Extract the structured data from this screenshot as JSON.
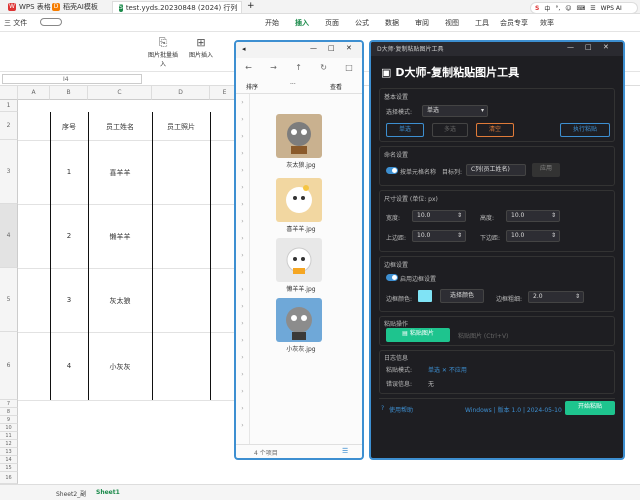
{
  "titlebar": {
    "tabs": [
      {
        "label": "WPS 表格",
        "icon": "wps-logo-icon",
        "color": "#d33"
      },
      {
        "label": "稻壳AI模板",
        "icon": "docer-logo-icon",
        "color": "#f57c00"
      },
      {
        "label": "test.yyds.20230848 (2024) 行列",
        "icon": "sheet-file-icon",
        "color": "#1a8a4a"
      }
    ],
    "new_tab": "+"
  },
  "sysbar": {
    "items": [
      "S",
      "中",
      "°,",
      "☺",
      "⌨",
      "☰",
      "WPS AI"
    ]
  },
  "menubar": {
    "items": [
      "三 文件",
      "开始插入",
      "",
      "开始",
      "插入",
      "页面",
      "公式",
      "数据",
      "审阅",
      "视图",
      "工具",
      "会员专享",
      "效率"
    ],
    "selected": "插入"
  },
  "ribbon": {
    "buttons": [
      {
        "label": "图片批量插入",
        "icon": "image-batch-icon"
      },
      {
        "label": "图片插入",
        "icon": "image-insert-icon"
      }
    ]
  },
  "formula": {
    "namebox": "I4"
  },
  "grid": {
    "columns": [
      "A",
      "B",
      "C",
      "D",
      "E"
    ],
    "rows": [
      "1",
      "2",
      "3",
      "4",
      "5",
      "6",
      "7",
      "8",
      "9",
      "10",
      "11",
      "12",
      "13",
      "14",
      "15",
      "16",
      "17",
      "18",
      "19",
      "20"
    ],
    "header": [
      "序号",
      "员工姓名",
      "员工照片"
    ],
    "data": [
      {
        "no": "1",
        "name": "喜羊羊"
      },
      {
        "no": "2",
        "name": "懒羊羊"
      },
      {
        "no": "3",
        "name": "灰太狼"
      },
      {
        "no": "4",
        "name": "小灰灰"
      }
    ]
  },
  "sheets": [
    "Sheet2_副",
    "Sheet1"
  ],
  "explorer": {
    "controls": [
      "—",
      "□",
      "✕"
    ],
    "nav": [
      "←",
      "→",
      "↑",
      "↻",
      "□"
    ],
    "sort_label": "排序",
    "more": "···",
    "view_label": "查看",
    "files": [
      {
        "name": "灰太狼.jpg",
        "icon": "wolf-image-icon",
        "color": "#c9b18f"
      },
      {
        "name": "喜羊羊.jpg",
        "icon": "pleasant-goat-image-icon",
        "color": "#f2d7a1"
      },
      {
        "name": "懒羊羊.jpg",
        "icon": "lazy-goat-image-icon",
        "color": "#e8e8e8"
      },
      {
        "name": "小灰灰.jpg",
        "icon": "little-wolf-image-icon",
        "color": "#6fa8d8"
      }
    ],
    "status": "4 个项目"
  },
  "tool": {
    "window_title": "D大师·复制粘贴图片工具",
    "controls": [
      "—",
      "□",
      "✕"
    ],
    "heading": "D大师-复制粘贴图片工具",
    "section_basic": "基本设置",
    "select_label": "选择模式:",
    "select_value": "单选",
    "btn_single": "单选",
    "btn_multi": "多选",
    "btn_clear": "清空",
    "btn_run": "执行粘贴",
    "section_name": "命名设置",
    "name_toggle_label": "按单元格名称",
    "name_target_label": "目标列:",
    "name_target_value": "C列(员工姓名)",
    "name_apply": "应用",
    "section_size": "尺寸设置 (单位: px)",
    "width_label": "宽度:",
    "width_value": "10.0",
    "height_label": "高度:",
    "height_value": "10.0",
    "top_label": "上边距:",
    "top_value": "10.0",
    "bottom_label": "下边距:",
    "bottom_value": "10.0",
    "section_border": "边框设置",
    "border_toggle_label": "启用边框设置",
    "border_color_label": "边框颜色:",
    "border_color": "#7fe3f5",
    "border_pick": "选择颜色",
    "border_width_label": "边框粗细:",
    "border_width_value": "2.0",
    "section_paste": "粘贴操作",
    "paste_btn": "粘贴图片",
    "paste_hint": "粘贴图片 (Ctrl+V)",
    "section_log": "日志信息",
    "log_mode_label": "粘贴模式:",
    "log_mode_value": "单选 ✕ 不应用",
    "log_error_label": "错误信息:",
    "log_error_value": "无",
    "footer_help": "使用帮助",
    "footer_info": "Windows | 版本 1.0 | 2024-05-10",
    "footer_btn": "开始粘贴",
    "accent": "#1ec48e",
    "blue": "#3d8fd1",
    "orange": "#e07b39"
  }
}
